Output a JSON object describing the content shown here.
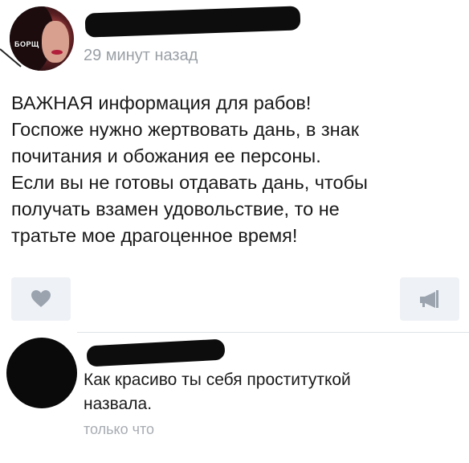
{
  "post": {
    "time": "29 минут назад",
    "avatar_label": "БОРЩ",
    "lines": [
      "ВАЖНАЯ информация для рабов!",
      "Госпоже нужно жертвовать дань, в знак",
      "почитания и обожания ее персоны.",
      "Если вы не готовы отдавать дань, чтобы",
      "получать взамен удовольствие, то не",
      "тратьте мое драгоценное время!"
    ]
  },
  "actions": {
    "like_icon": "heart-icon",
    "share_icon": "megaphone-icon"
  },
  "comment": {
    "lines": [
      "Как красиво ты себя проституткой",
      "назвала."
    ],
    "time": "только что"
  },
  "colors": {
    "background": "#ffffff",
    "button_bg": "#eef1f5",
    "icon": "#9aa3ae",
    "muted_text": "#9aa0a6",
    "redaction": "#0d0d0d"
  }
}
